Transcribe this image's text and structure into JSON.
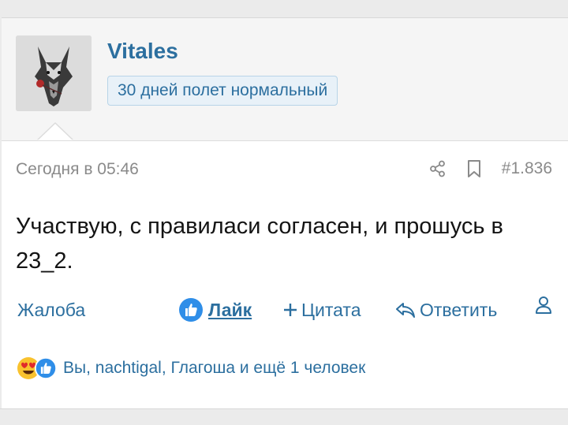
{
  "user": {
    "name": "Vitales",
    "title": "30 дней полет нормальный",
    "avatar_icon": "wolf-avatar"
  },
  "post": {
    "date": "Сегодня в 05:46",
    "number": "#1.836",
    "message": "Участвую, с правиласи согласен, и прошусь в 23_2."
  },
  "actions": {
    "report": "Жалоба",
    "like": "Лайк",
    "quote": "Цитата",
    "reply": "Ответить"
  },
  "reactions": {
    "text": "Вы, nachtigal, Глагоша и ещё 1 человек"
  },
  "colors": {
    "accent": "#2c6f9f",
    "like_blue": "#2f8ee8",
    "muted": "#8a8a8a"
  }
}
